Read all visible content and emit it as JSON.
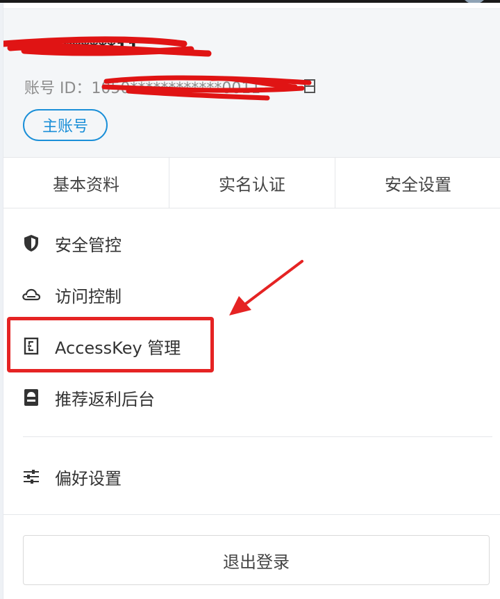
{
  "account": {
    "username": "xiao******11",
    "id_label": "账号 ID：",
    "id_value": "1050************0011",
    "badge": "主账号"
  },
  "tabs": [
    {
      "label": "基本资料"
    },
    {
      "label": "实名认证"
    },
    {
      "label": "安全设置"
    }
  ],
  "menu": {
    "items": [
      {
        "label": "安全管控",
        "icon": "shield-icon"
      },
      {
        "label": "访问控制",
        "icon": "cloud-icon"
      },
      {
        "label": "AccessKey 管理",
        "icon": "accesskey-icon"
      },
      {
        "label": "推荐返利后台",
        "icon": "rebate-icon"
      }
    ],
    "preferences": {
      "label": "偏好设置",
      "icon": "sliders-icon"
    }
  },
  "logout_label": "退出登录",
  "annotation": {
    "color": "#e52323",
    "target": "AccessKey 管理"
  }
}
